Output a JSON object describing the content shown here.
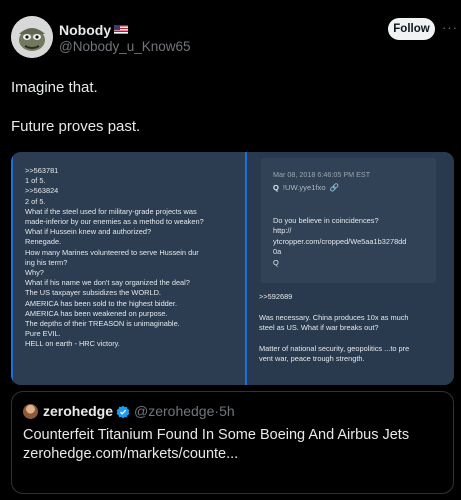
{
  "post": {
    "author_name": "Nobody",
    "author_handle": "@Nobody_u_Know65",
    "follow_label": "Follow",
    "more_label": "···",
    "text_lines": [
      "Imagine that.",
      "Future proves past."
    ]
  },
  "media": {
    "left_lines": [
      ">>563781",
      "1 of 5.",
      ">>563824",
      "2 of 5.",
      "What if the steel used for military-grade projects was",
      "made-inferior by our enemies as a method to weaken?",
      "What if Hussein knew and authorized?",
      "Renegade.",
      "How many Marines volunteered to serve Hussein dur",
      "ing his term?",
      "Why?",
      "What if his name we don't say organized the deal?",
      "The US taxpayer subsidizes the WORLD.",
      "AMERICA has been sold to the highest bidder.",
      "AMERICA has been weakened on purpose.",
      "The depths of their TREASON is unimaginable.",
      "Pure EVIL.",
      "HELL on earth - HRC victory."
    ],
    "q_post": {
      "date": "Mar 08, 2018 6:46:05 PM EST",
      "name": "Q",
      "tripcode": "!UW.yye1fxo",
      "body_lines": [
        "Do you believe in coincidences?",
        "http://",
        "ytcropper.com/cropped/We5aa1b3278dd",
        "0a",
        "Q"
      ]
    },
    "right_lines": [
      ">>592689",
      "",
      "Was necessary. China produces 10x as much",
      "steel as US. What if war breaks out?",
      "",
      "Matter of national security, geopolitics ...to pre",
      "vent war, peace trough strength."
    ]
  },
  "quoted": {
    "author_name": "zerohedge",
    "author_handle": "@zerohedge",
    "time": "5h",
    "text_line1": "Counterfeit Titanium Found In Some Boeing And Airbus Jets",
    "text_line2": "zerohedge.com/markets/counte..."
  },
  "colors": {
    "background": "#000000",
    "text": "#e7e9ea",
    "secondary_text": "#71767b",
    "verified_badge": "#1d9bf0",
    "accent_blue": "#1d6fdc"
  }
}
